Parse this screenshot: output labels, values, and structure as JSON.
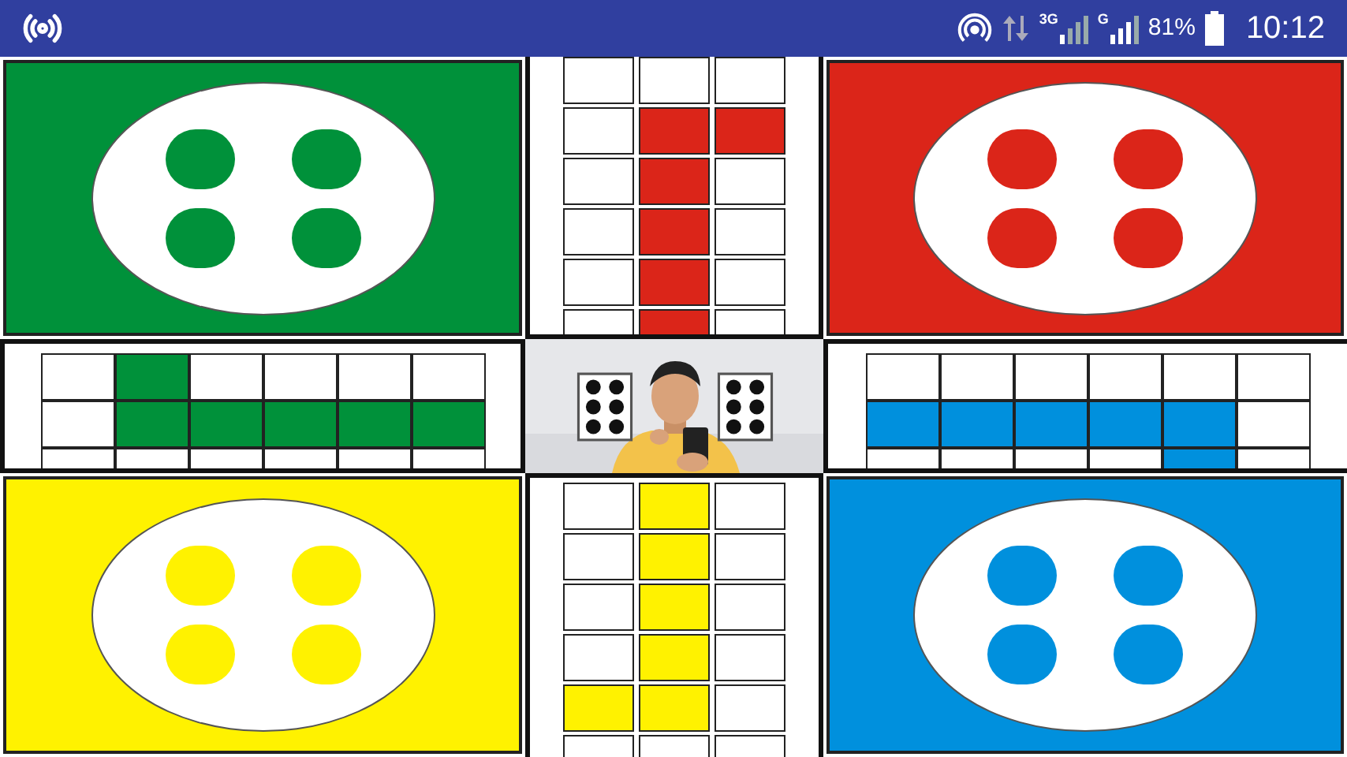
{
  "status_bar": {
    "percent": "81%",
    "time": "10:12",
    "network_1": "3G",
    "network_2": "G"
  },
  "homes": [
    {
      "color": "#00913a"
    },
    {
      "color": "#db2519"
    },
    {
      "color": "#fff200"
    },
    {
      "color": "#0090dd"
    }
  ],
  "tracks": [
    {
      "kind": "vertical",
      "color": "#db2519",
      "cells": [
        [
          false,
          false,
          false
        ],
        [
          false,
          true,
          true
        ],
        [
          false,
          true,
          false
        ],
        [
          false,
          true,
          false
        ],
        [
          false,
          true,
          false
        ],
        [
          false,
          true,
          false
        ]
      ]
    },
    {
      "kind": "horizontal",
      "color": "#00913a",
      "cells": [
        [
          false,
          true,
          false,
          false,
          false,
          false
        ],
        [
          false,
          true,
          true,
          true,
          true,
          true
        ],
        [
          false,
          false,
          false,
          false,
          false,
          false
        ]
      ]
    },
    {
      "kind": "horizontal",
      "color": "#0090dd",
      "cells": [
        [
          false,
          false,
          false,
          false,
          false,
          false
        ],
        [
          true,
          true,
          true,
          true,
          true,
          false
        ],
        [
          false,
          false,
          false,
          false,
          true,
          false
        ]
      ]
    },
    {
      "kind": "vertical",
      "color": "#fff200",
      "cells": [
        [
          false,
          true,
          false
        ],
        [
          false,
          true,
          false
        ],
        [
          false,
          true,
          false
        ],
        [
          false,
          true,
          false
        ],
        [
          true,
          true,
          false
        ],
        [
          false,
          false,
          false
        ]
      ]
    }
  ]
}
